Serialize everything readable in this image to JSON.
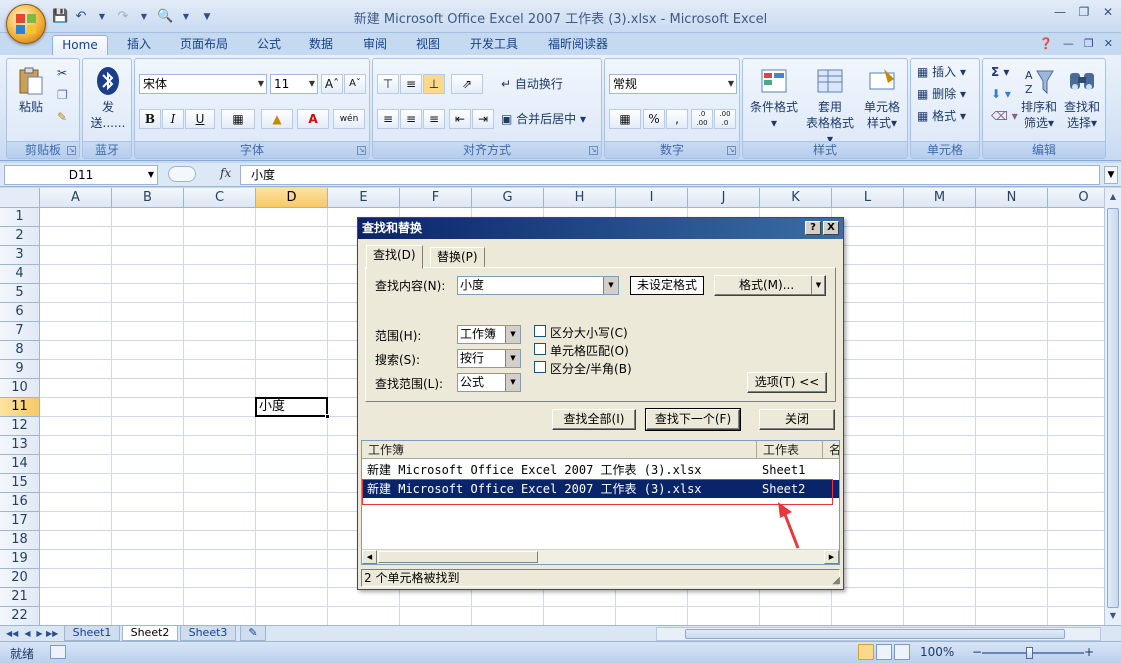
{
  "window": {
    "title": "新建 Microsoft Office Excel 2007 工作表 (3).xlsx - Microsoft Excel"
  },
  "ribbon_tabs": [
    "Home",
    "插入",
    "页面布局",
    "公式",
    "数据",
    "审阅",
    "视图",
    "开发工具",
    "福昕阅读器"
  ],
  "ribbon": {
    "clipboard": {
      "label": "剪贴板",
      "paste": "粘贴"
    },
    "bluetooth": {
      "label": "蓝牙",
      "send": "发",
      "send2": "送......"
    },
    "font": {
      "label": "字体",
      "name": "宋体",
      "size": "11",
      "bold": "B",
      "italic": "I",
      "underline": "U",
      "phonetic": "wén"
    },
    "alignment": {
      "label": "对齐方式",
      "wrap": "自动换行",
      "merge": "合并后居中"
    },
    "number": {
      "label": "数字",
      "format": "常规",
      "percent": "%",
      "comma": ",",
      "inc": ".0 .00",
      "dec": ".00 .0"
    },
    "styles": {
      "label": "样式",
      "conditional": "条件格式",
      "table": "套用",
      "table2": "表格格式",
      "cell": "单元格",
      "cell2": "样式"
    },
    "cells": {
      "label": "单元格",
      "insert": "插入",
      "delete": "删除",
      "format": "格式"
    },
    "editing": {
      "label": "编辑",
      "sort": "排序和",
      "sort2": "筛选",
      "find": "查找和",
      "find2": "选择",
      "sum": "Σ"
    }
  },
  "formula_bar": {
    "name_box": "D11",
    "fx": "fx",
    "value": "小度"
  },
  "grid": {
    "columns": [
      "A",
      "B",
      "C",
      "D",
      "E",
      "F",
      "G",
      "H",
      "I",
      "J",
      "K",
      "L",
      "M",
      "N",
      "O"
    ],
    "rows": [
      "1",
      "2",
      "3",
      "4",
      "5",
      "6",
      "7",
      "8",
      "9",
      "10",
      "11",
      "12",
      "13",
      "14",
      "15",
      "16",
      "17",
      "18",
      "19",
      "20",
      "21",
      "22"
    ],
    "selected_column": "D",
    "selected_row": "11",
    "cell_D11": "小度"
  },
  "sheets": [
    "Sheet1",
    "Sheet2",
    "Sheet3"
  ],
  "active_sheet": "Sheet2",
  "status": {
    "ready": "就绪",
    "zoom": "100%"
  },
  "dialog": {
    "title": "查找和替换",
    "help": "?",
    "close": "X",
    "tabs": [
      "查找(D)",
      "替换(P)"
    ],
    "find_what_label": "查找内容(N):",
    "find_what_value": "小度",
    "no_format": "未设定格式",
    "format_button": "格式(M)...",
    "within_label": "范围(H):",
    "within_value": "工作簿",
    "search_label": "搜索(S):",
    "search_value": "按行",
    "look_in_label": "查找范围(L):",
    "look_in_value": "公式",
    "match_case": "区分大小写(C)",
    "match_entire": "单元格匹配(O)",
    "match_width": "区分全/半角(B)",
    "options_button": "选项(T) <<",
    "find_all": "查找全部(I)",
    "find_next": "查找下一个(F)",
    "close_button": "关闭",
    "results": {
      "headers": [
        "工作簿",
        "工作表",
        "名"
      ],
      "rows": [
        {
          "workbook": "新建 Microsoft Office Excel 2007 工作表 (3).xlsx",
          "sheet": "Sheet1"
        },
        {
          "workbook": "新建 Microsoft Office Excel 2007 工作表 (3).xlsx",
          "sheet": "Sheet2"
        }
      ]
    },
    "status": "2 个单元格被找到"
  },
  "colors": {
    "selection": "#0a246a",
    "annotation": "#e8383d"
  }
}
